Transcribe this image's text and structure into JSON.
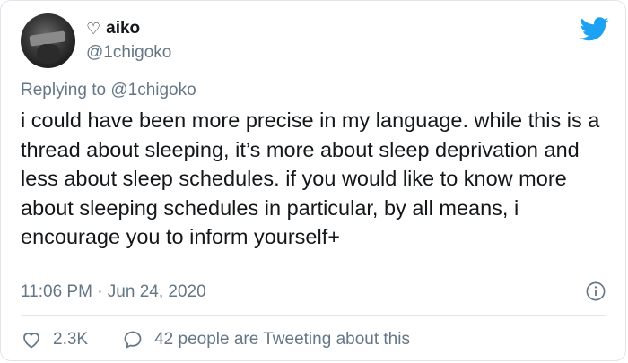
{
  "author": {
    "display_name": "aiko",
    "name_prefix_glyph": "♡",
    "handle": "@1chigoko"
  },
  "reply": {
    "prefix": "Replying to ",
    "mention": "@1chigoko"
  },
  "tweet": {
    "text": "i could have been more precise in my language. while this is a thread about sleeping, it’s more about sleep deprivation and less about sleep schedules. if you would like to know more about sleeping schedules in particular, by all means, i encourage you to inform yourself+"
  },
  "meta": {
    "timestamp": "11:06 PM · Jun 24, 2020"
  },
  "actions": {
    "likes": "2.3K",
    "discussion": "42 people are Tweeting about this"
  },
  "icons": {
    "brand": "twitter-bird-icon",
    "info": "info-icon",
    "like": "heart-icon",
    "discussion": "speech-bubble-icon"
  },
  "colors": {
    "brand": "#1da1f2",
    "secondary_text": "#657786",
    "primary_text": "#14171a"
  }
}
